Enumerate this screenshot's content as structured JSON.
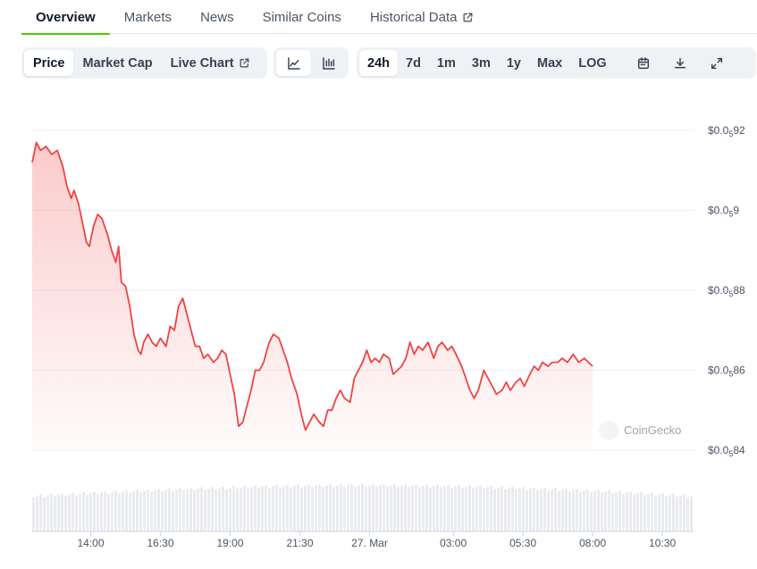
{
  "tabs": [
    {
      "label": "Overview",
      "active": true
    },
    {
      "label": "Markets"
    },
    {
      "label": "News"
    },
    {
      "label": "Similar Coins"
    },
    {
      "label": "Historical Data",
      "external": true
    }
  ],
  "toolbar": {
    "view_buttons": [
      {
        "label": "Price",
        "selected": true
      },
      {
        "label": "Market Cap"
      },
      {
        "label": "Live Chart",
        "external": true
      }
    ],
    "chart_types": [
      {
        "icon": "line-chart-icon",
        "selected": true
      },
      {
        "icon": "candlestick-chart-icon"
      }
    ],
    "ranges": [
      {
        "label": "24h",
        "selected": true
      },
      {
        "label": "7d"
      },
      {
        "label": "1m"
      },
      {
        "label": "3m"
      },
      {
        "label": "1y"
      },
      {
        "label": "Max"
      },
      {
        "label": "LOG"
      }
    ],
    "tools": [
      {
        "icon": "calendar-icon"
      },
      {
        "icon": "download-icon"
      },
      {
        "icon": "fullscreen-icon"
      }
    ]
  },
  "watermark": "CoinGecko",
  "colors": {
    "line": "#ef4444",
    "accent": "#4bcc00",
    "volume": "#e5e7eb"
  },
  "chart_data": {
    "type": "line",
    "y_ticks": [
      {
        "prefix": "$0.0",
        "sub": "5",
        "rest": "92",
        "value": 0.0592
      },
      {
        "prefix": "$0.0",
        "sub": "5",
        "rest": "9",
        "value": 0.059
      },
      {
        "prefix": "$0.0",
        "sub": "5",
        "rest": "88",
        "value": 0.0588
      },
      {
        "prefix": "$0.0",
        "sub": "5",
        "rest": "86",
        "value": 0.0586
      },
      {
        "prefix": "$0.0",
        "sub": "5",
        "rest": "84",
        "value": 0.0584
      }
    ],
    "ylim": [
      0.0584,
      0.0592
    ],
    "x_ticks": [
      {
        "label": "14:00",
        "hour": 2
      },
      {
        "label": "16:30",
        "hour": 4.5
      },
      {
        "label": "19:00",
        "hour": 7
      },
      {
        "label": "21:30",
        "hour": 9.5
      },
      {
        "label": "27. Mar",
        "hour": 12
      },
      {
        "label": "03:00",
        "hour": 15
      },
      {
        "label": "05:30",
        "hour": 17.5
      },
      {
        "label": "08:00",
        "hour": 20
      },
      {
        "label": "10:30",
        "hour": 22.5
      }
    ],
    "xlim": [
      -0.1,
      23.65
    ],
    "series": [
      {
        "values": [
          [
            -0.1,
            0.05912
          ],
          [
            0.05,
            0.05917
          ],
          [
            0.2,
            0.05915
          ],
          [
            0.4,
            0.05916
          ],
          [
            0.6,
            0.05914
          ],
          [
            0.8,
            0.05915
          ],
          [
            1,
            0.05911
          ],
          [
            1.15,
            0.05906
          ],
          [
            1.3,
            0.05903
          ],
          [
            1.4,
            0.05905
          ],
          [
            1.55,
            0.05902
          ],
          [
            1.7,
            0.05897
          ],
          [
            1.85,
            0.05892
          ],
          [
            1.95,
            0.05891
          ],
          [
            2.1,
            0.05896
          ],
          [
            2.25,
            0.05899
          ],
          [
            2.4,
            0.05898
          ],
          [
            2.6,
            0.05894
          ],
          [
            2.75,
            0.0589
          ],
          [
            2.9,
            0.05887
          ],
          [
            3,
            0.05891
          ],
          [
            3.1,
            0.05882
          ],
          [
            3.25,
            0.05881
          ],
          [
            3.4,
            0.05876
          ],
          [
            3.55,
            0.05869
          ],
          [
            3.7,
            0.05865
          ],
          [
            3.8,
            0.05864
          ],
          [
            3.9,
            0.05867
          ],
          [
            4.05,
            0.05869
          ],
          [
            4.2,
            0.05867
          ],
          [
            4.35,
            0.05866
          ],
          [
            4.5,
            0.05868
          ],
          [
            4.7,
            0.05866
          ],
          [
            4.85,
            0.05871
          ],
          [
            5,
            0.0587
          ],
          [
            5.15,
            0.05876
          ],
          [
            5.3,
            0.05878
          ],
          [
            5.45,
            0.05874
          ],
          [
            5.6,
            0.0587
          ],
          [
            5.75,
            0.05866
          ],
          [
            5.9,
            0.05866
          ],
          [
            6.05,
            0.05863
          ],
          [
            6.2,
            0.05864
          ],
          [
            6.4,
            0.05862
          ],
          [
            6.55,
            0.05863
          ],
          [
            6.7,
            0.05865
          ],
          [
            6.85,
            0.05864
          ],
          [
            7,
            0.05859
          ],
          [
            7.15,
            0.05854
          ],
          [
            7.3,
            0.05846
          ],
          [
            7.45,
            0.05847
          ],
          [
            7.6,
            0.05851
          ],
          [
            7.75,
            0.05855
          ],
          [
            7.9,
            0.0586
          ],
          [
            8.05,
            0.0586
          ],
          [
            8.2,
            0.05862
          ],
          [
            8.4,
            0.05867
          ],
          [
            8.55,
            0.05869
          ],
          [
            8.75,
            0.05868
          ],
          [
            8.9,
            0.05865
          ],
          [
            9.05,
            0.05862
          ],
          [
            9.2,
            0.05858
          ],
          [
            9.4,
            0.05854
          ],
          [
            9.55,
            0.05849
          ],
          [
            9.7,
            0.05845
          ],
          [
            9.85,
            0.05847
          ],
          [
            10,
            0.05849
          ],
          [
            10.2,
            0.05847
          ],
          [
            10.35,
            0.05846
          ],
          [
            10.5,
            0.0585
          ],
          [
            10.65,
            0.0585
          ],
          [
            10.8,
            0.05853
          ],
          [
            10.95,
            0.05855
          ],
          [
            11.1,
            0.05853
          ],
          [
            11.3,
            0.05852
          ],
          [
            11.45,
            0.05858
          ],
          [
            11.6,
            0.0586
          ],
          [
            11.75,
            0.05862
          ],
          [
            11.9,
            0.05865
          ],
          [
            12.05,
            0.05862
          ],
          [
            12.2,
            0.05863
          ],
          [
            12.35,
            0.05862
          ],
          [
            12.5,
            0.05864
          ],
          [
            12.7,
            0.05863
          ],
          [
            12.85,
            0.05859
          ],
          [
            13,
            0.0586
          ],
          [
            13.15,
            0.05861
          ],
          [
            13.3,
            0.05863
          ],
          [
            13.45,
            0.05867
          ],
          [
            13.6,
            0.05864
          ],
          [
            13.75,
            0.05866
          ],
          [
            13.9,
            0.05865
          ],
          [
            14.1,
            0.05867
          ],
          [
            14.3,
            0.05863
          ],
          [
            14.45,
            0.05866
          ],
          [
            14.6,
            0.05867
          ],
          [
            14.8,
            0.05865
          ],
          [
            14.95,
            0.05866
          ],
          [
            15.1,
            0.05864
          ],
          [
            15.3,
            0.05861
          ],
          [
            15.45,
            0.05858
          ],
          [
            15.6,
            0.05855
          ],
          [
            15.75,
            0.05853
          ],
          [
            15.9,
            0.05855
          ],
          [
            16.1,
            0.0586
          ],
          [
            16.25,
            0.05858
          ],
          [
            16.4,
            0.05856
          ],
          [
            16.55,
            0.05854
          ],
          [
            16.75,
            0.05855
          ],
          [
            16.9,
            0.05857
          ],
          [
            17.05,
            0.05855
          ],
          [
            17.25,
            0.05857
          ],
          [
            17.4,
            0.05858
          ],
          [
            17.55,
            0.05856
          ],
          [
            17.75,
            0.05859
          ],
          [
            17.9,
            0.05861
          ],
          [
            18.05,
            0.0586
          ],
          [
            18.2,
            0.05862
          ],
          [
            18.4,
            0.05861
          ],
          [
            18.55,
            0.05862
          ],
          [
            18.75,
            0.05862
          ],
          [
            18.9,
            0.05863
          ],
          [
            19.1,
            0.05862
          ],
          [
            19.3,
            0.05864
          ],
          [
            19.5,
            0.05862
          ],
          [
            19.7,
            0.05863
          ],
          [
            19.85,
            0.05862
          ],
          [
            20,
            0.05861
          ]
        ]
      }
    ]
  }
}
